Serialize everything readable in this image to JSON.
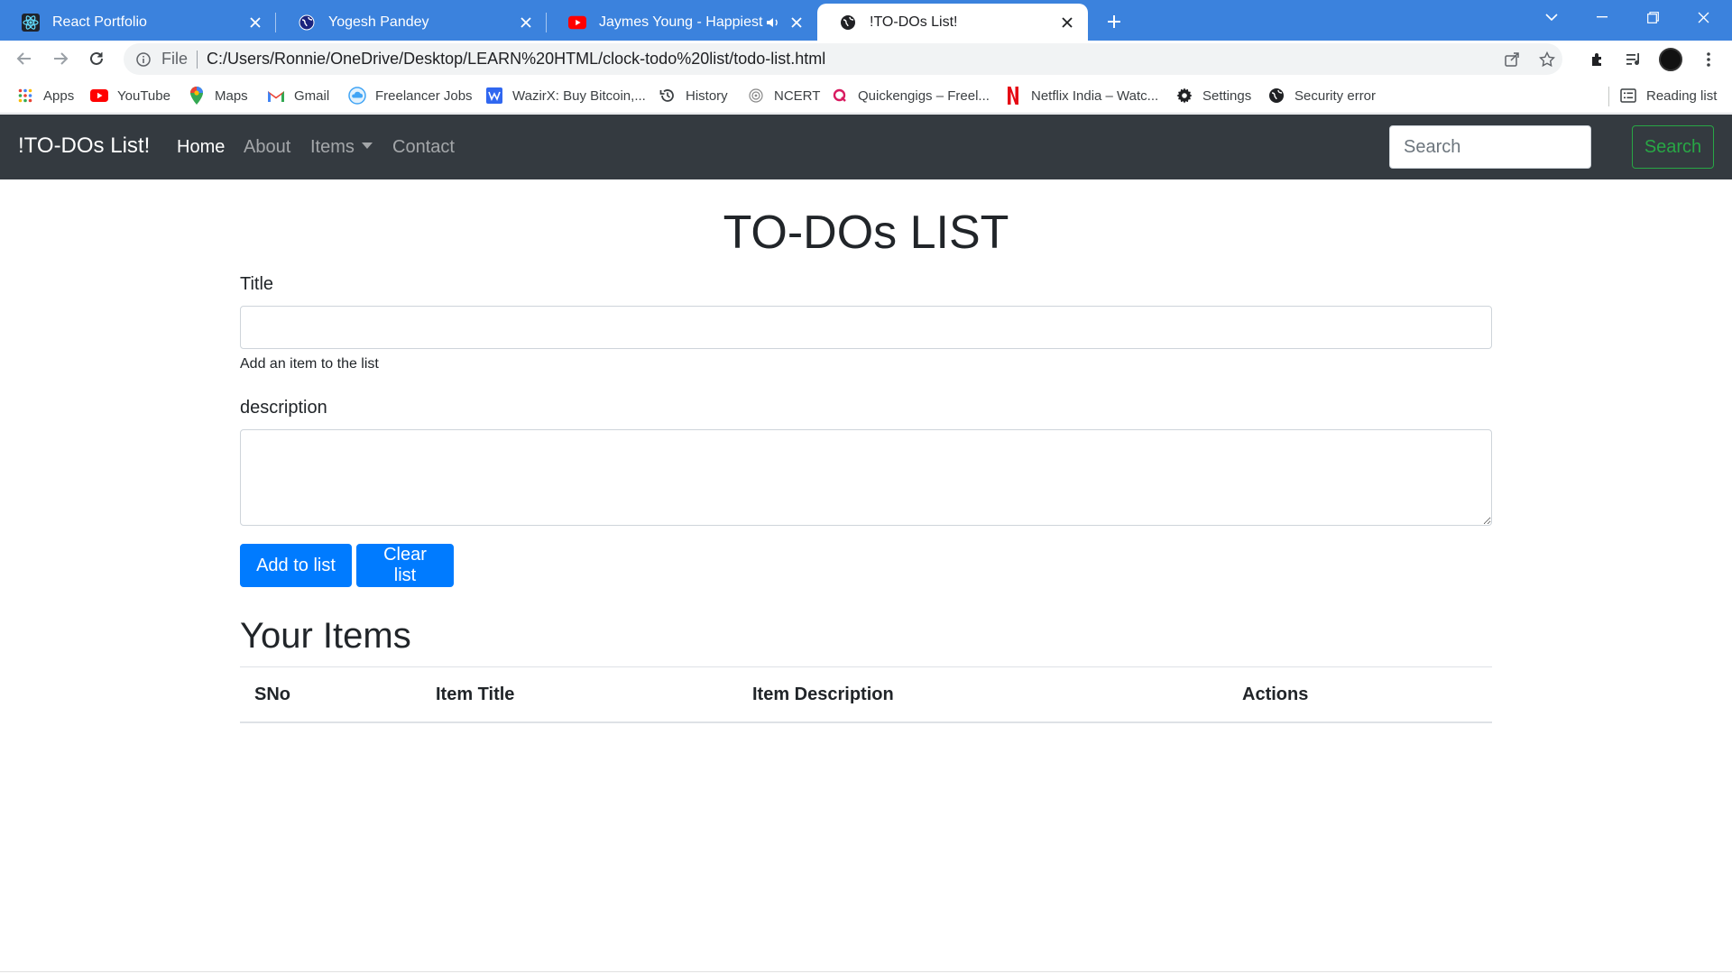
{
  "browser": {
    "tabs": [
      {
        "title": "React Portfolio",
        "icon": "react-icon",
        "active": false
      },
      {
        "title": "Yogesh Pandey",
        "icon": "globe-icon",
        "active": false
      },
      {
        "title": "Jaymes Young - Happiest Yea",
        "icon": "youtube-icon",
        "active": false,
        "audio": true
      },
      {
        "title": "!TO-DOs List!",
        "icon": "globe-icon",
        "active": true
      }
    ],
    "address": {
      "scheme_label": "File",
      "url": "C:/Users/Ronnie/OneDrive/Desktop/LEARN%20HTML/clock-todo%20list/todo-list.html"
    },
    "bookmarks": [
      {
        "label": "Apps",
        "icon": "apps-grid-icon"
      },
      {
        "label": "YouTube",
        "icon": "youtube-icon"
      },
      {
        "label": "Maps",
        "icon": "maps-pin-icon"
      },
      {
        "label": "Gmail",
        "icon": "gmail-icon"
      },
      {
        "label": "Freelancer Jobs",
        "icon": "cloud-icon"
      },
      {
        "label": "WazirX: Buy Bitcoin,...",
        "icon": "wazirx-icon"
      },
      {
        "label": "History",
        "icon": "history-icon"
      },
      {
        "label": "NCERT",
        "icon": "ncert-icon"
      },
      {
        "label": "Quickengigs – Freel...",
        "icon": "quickengigs-icon"
      },
      {
        "label": "Netflix India – Watc...",
        "icon": "netflix-icon"
      },
      {
        "label": "Settings",
        "icon": "gear-icon"
      },
      {
        "label": "Security error",
        "icon": "globe-icon"
      }
    ],
    "reading_list": "Reading list"
  },
  "navbar": {
    "brand": "!TO-DOs List!",
    "links": [
      {
        "label": "Home",
        "active": true
      },
      {
        "label": "About",
        "active": false
      },
      {
        "label": "Items",
        "active": false,
        "dropdown": true
      },
      {
        "label": "Contact",
        "active": false
      }
    ],
    "search_placeholder": "Search",
    "search_button": "Search"
  },
  "main": {
    "heading": "TO-DOs LIST",
    "title_label": "Title",
    "title_value": "",
    "title_help": "Add an item to the list",
    "description_label": "description",
    "description_value": "",
    "add_button": "Add to list",
    "clear_button": "Clear list",
    "items_heading": "Your Items",
    "table_headers": [
      "SNo",
      "Item Title",
      "Item Description",
      "Actions"
    ],
    "rows": []
  },
  "colors": {
    "tabstrip": "#3b82dd",
    "navbar": "#343a40",
    "primary": "#007bff",
    "success": "#28a745"
  }
}
